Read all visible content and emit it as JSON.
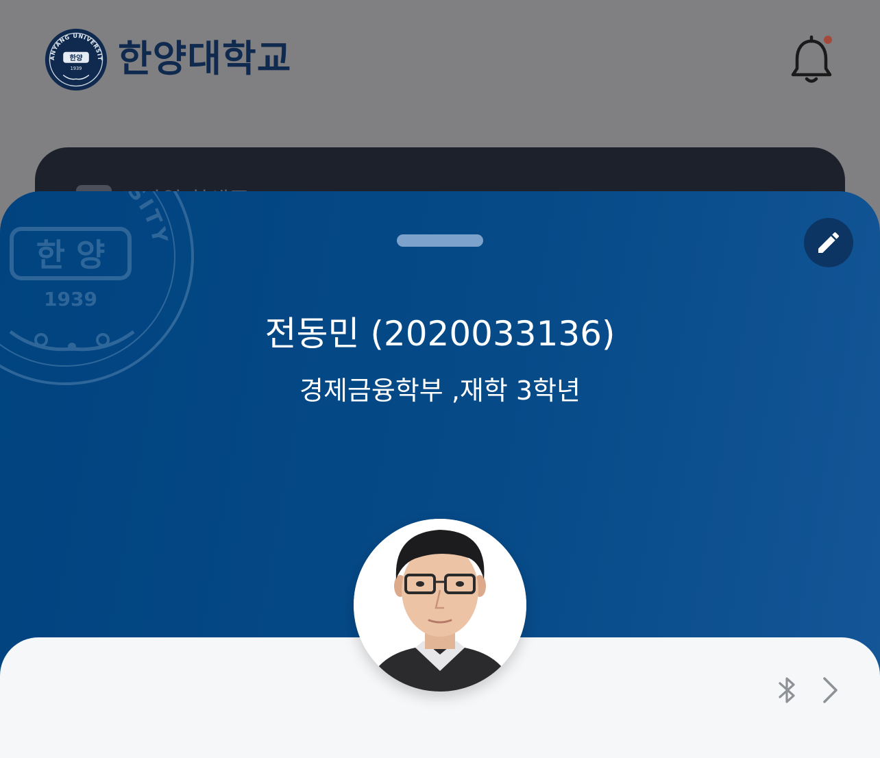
{
  "header": {
    "university_name": "한양대학교",
    "seal": {
      "top_text": "HANYANG UNIVERSITY",
      "center_text": "한양",
      "year": "1939"
    },
    "notification_icon": "bell-icon",
    "notification_dot_color": "#a54a3a"
  },
  "background_card": {
    "label": "모바일 학생증"
  },
  "id_card": {
    "watermark": {
      "arc_text": "RSITY",
      "center_text": "한 양",
      "year": "1939"
    },
    "edit_icon": "pencil-icon",
    "name_line": "전동민 (2020033136)",
    "dept_line": "경제금융학부 ,재학 3학년",
    "photo_icon": "student-photo",
    "colors": {
      "card_blue": "#00437f",
      "card_blue_light": "#145697",
      "panel": "#f6f7f9"
    }
  },
  "footer": {
    "bluetooth_icon": "bluetooth-icon",
    "chevron_icon": "chevron-right-icon"
  }
}
